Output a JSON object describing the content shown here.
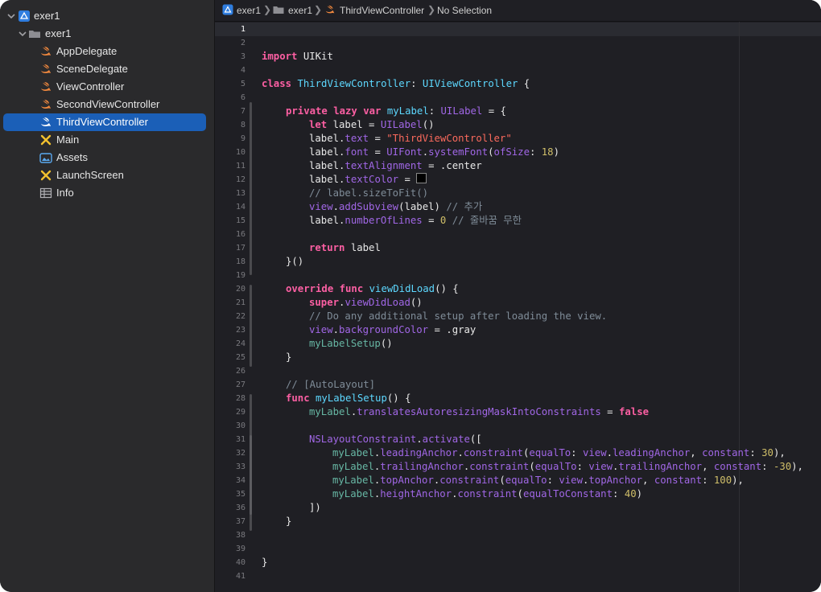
{
  "navigator": {
    "project": "exer1",
    "group": "exer1",
    "files": [
      {
        "name": "AppDelegate",
        "icon": "swift-icon"
      },
      {
        "name": "SceneDelegate",
        "icon": "swift-icon"
      },
      {
        "name": "ViewController",
        "icon": "swift-icon"
      },
      {
        "name": "SecondViewController",
        "icon": "swift-icon"
      },
      {
        "name": "ThirdViewController",
        "icon": "swift-icon",
        "selected": true
      },
      {
        "name": "Main",
        "icon": "storyboard-icon"
      },
      {
        "name": "Assets",
        "icon": "asset-catalog-icon"
      },
      {
        "name": "LaunchScreen",
        "icon": "storyboard-icon"
      },
      {
        "name": "Info",
        "icon": "plist-icon"
      }
    ]
  },
  "jumpbar": {
    "project": "exer1",
    "group": "exer1",
    "file": "ThirdViewController",
    "selection": "No Selection"
  },
  "editor": {
    "current_line": 1,
    "line_numbers": [
      "1",
      "2",
      "3",
      "4",
      "5",
      "6",
      "7",
      "8",
      "9",
      "10",
      "11",
      "12",
      "13",
      "14",
      "15",
      "16",
      "17",
      "18",
      "19",
      "20",
      "21",
      "22",
      "23",
      "24",
      "25",
      "26",
      "27",
      "28",
      "29",
      "30",
      "31",
      "32",
      "33",
      "34",
      "35",
      "36",
      "37",
      "38",
      "39",
      "40",
      "41"
    ],
    "code": {
      "l3_kw": "import",
      "l3_rest": " UIKit",
      "l5_kw": "class",
      "l5_name": "ThirdViewController",
      "l5_colon": ": ",
      "l5_super": "UIViewController",
      "l5_brace": " {",
      "l7_kw": "private lazy var",
      "l7_name": "myLabel",
      "l7_colon": ": ",
      "l7_type": "UILabel",
      "l7_rest": " = {",
      "l8_kw": "let",
      "l8_mid": " label = ",
      "l8_type": "UILabel",
      "l8_rest": "()",
      "l9_a": "label.",
      "l9_prop": "text",
      "l9_eq": " = ",
      "l9_str": "\"ThirdViewController\"",
      "l10_a": "label.",
      "l10_prop": "font",
      "l10_eq": " = ",
      "l10_type": "UIFont",
      "l10_dot": ".",
      "l10_fn": "systemFont",
      "l10_p1": "(",
      "l10_arg": "ofSize",
      "l10_p2": ": ",
      "l10_num": "18",
      "l10_p3": ")",
      "l11_a": "label.",
      "l11_prop": "textAlignment",
      "l11_rest": " = .center",
      "l12_a": "label.",
      "l12_prop": "textColor",
      "l12_eq": " = ",
      "l13_comment": "// label.sizeToFit()",
      "l14_a": "view",
      "l14_dot": ".",
      "l14_fn": "addSubview",
      "l14_rest": "(label) ",
      "l14_comment": "// 추가",
      "l15_a": "label.",
      "l15_prop": "numberOfLines",
      "l15_eq": " = ",
      "l15_num": "0",
      "l15_sp": " ",
      "l15_comment": "// 줄바꿈 무한",
      "l17_kw": "return",
      "l17_rest": " label",
      "l18": "}()",
      "l20_kw": "override func",
      "l20_fn": " viewDidLoad",
      "l20_rest": "() {",
      "l21_kw": "super",
      "l21_dot": ".",
      "l21_fn": "viewDidLoad",
      "l21_rest": "()",
      "l22_comment": "// Do any additional setup after loading the view.",
      "l23_a": "view",
      "l23_dot": ".",
      "l23_prop": "backgroundColor",
      "l23_rest": " = .gray",
      "l24_fn": "myLabelSetup",
      "l24_rest": "()",
      "l25": "}",
      "l27_comment": "// [AutoLayout]",
      "l28_kw": "func",
      "l28_fn": " myLabelSetup",
      "l28_rest": "() {",
      "l29_a": "myLabel",
      "l29_dot": ".",
      "l29_prop": "translatesAutoresizingMaskIntoConstraints",
      "l29_eq": " = ",
      "l29_kw": "false",
      "l31_type": "NSLayoutConstraint",
      "l31_dot": ".",
      "l31_fn": "activate",
      "l31_rest": "([",
      "l32_a": "myLabel",
      "l32_b": ".",
      "l32_prop": "leadingAnchor",
      "l32_c": ".",
      "l32_fn": "constraint",
      "l32_d": "(",
      "l32_arg": "equalTo",
      "l32_e": ": ",
      "l32_v": "view",
      "l32_f": ".",
      "l32_prop2": "leadingAnchor",
      "l32_g": ", ",
      "l32_arg2": "constant",
      "l32_h": ": ",
      "l32_num": "30",
      "l32_i": "),",
      "l33_a": "myLabel",
      "l33_b": ".",
      "l33_prop": "trailingAnchor",
      "l33_c": ".",
      "l33_fn": "constraint",
      "l33_d": "(",
      "l33_arg": "equalTo",
      "l33_e": ": ",
      "l33_v": "view",
      "l33_f": ".",
      "l33_prop2": "trailingAnchor",
      "l33_g": ", ",
      "l33_arg2": "constant",
      "l33_h": ": ",
      "l33_num": "-30",
      "l33_i": "),",
      "l34_a": "myLabel",
      "l34_b": ".",
      "l34_prop": "topAnchor",
      "l34_c": ".",
      "l34_fn": "constraint",
      "l34_d": "(",
      "l34_arg": "equalTo",
      "l34_e": ": ",
      "l34_v": "view",
      "l34_f": ".",
      "l34_prop2": "topAnchor",
      "l34_g": ", ",
      "l34_arg2": "constant",
      "l34_h": ": ",
      "l34_num": "100",
      "l34_i": "),",
      "l35_a": "myLabel",
      "l35_b": ".",
      "l35_prop": "heightAnchor",
      "l35_c": ".",
      "l35_fn": "constraint",
      "l35_d": "(",
      "l35_arg": "equalToConstant",
      "l35_e": ": ",
      "l35_num": "40",
      "l35_i": ")",
      "l36": "])",
      "l37": "}",
      "l40": "}"
    }
  },
  "colors": {
    "selection": "#1b5fb7",
    "keyword": "#fc5fa3",
    "type": "#5dd8ff",
    "property": "#a167e6",
    "string": "#fc6a5d",
    "number": "#d0bf69",
    "comment": "#7f8c98"
  }
}
